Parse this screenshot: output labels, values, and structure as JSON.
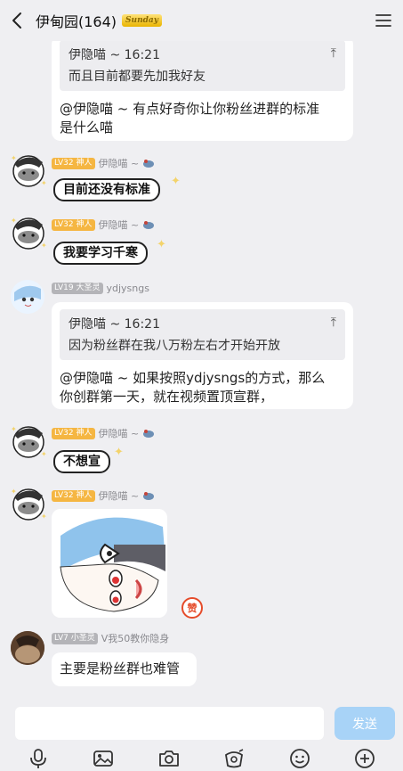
{
  "header": {
    "title": "伊甸园(164)",
    "badge": "Sunday"
  },
  "messages": {
    "m1": {
      "quote_author_time": "伊隐喵 ~  16:21",
      "quote_text": "而且目前都要先加我好友",
      "text_line1": "@伊隐喵 ~  有点好奇你让你粉丝进群的标准",
      "text_line2": "是什么喵"
    },
    "m2": {
      "level": "LV32 神人",
      "name": "伊隐喵 ~",
      "sticker_text": "目前还没有标准"
    },
    "m3": {
      "level": "LV32 神人",
      "name": "伊隐喵 ~",
      "sticker_text": "我要学习千寒"
    },
    "m4": {
      "level": "LV19 大圣灵",
      "name": "ydjysngs",
      "quote_author_time": "伊隐喵 ~  16:21",
      "quote_text": "因为粉丝群在我八万粉左右才开始开放",
      "text_line1": "@伊隐喵 ~  如果按照ydjysngs的方式，那么",
      "text_line2": "你创群第一天，就在视频置顶宣群，"
    },
    "m5": {
      "level": "LV32 神人",
      "name": "伊隐喵 ~",
      "sticker_text": "不想宣"
    },
    "m6": {
      "level": "LV32 神人",
      "name": "伊隐喵 ~",
      "reaction": "赞"
    },
    "m7": {
      "level": "LV7 小圣灵",
      "name": "V我50教你隐身",
      "text": "主要是粉丝群也难管"
    }
  },
  "composer": {
    "placeholder": "",
    "send_label": "发送"
  },
  "toolbar": {
    "items": [
      "microphone-icon",
      "image-icon",
      "camera-icon",
      "red-packet-icon",
      "emoji-icon",
      "plus-icon"
    ]
  },
  "colors": {
    "background": "#efeff2",
    "send_button": "#a8d3f7",
    "level_gold": "#f5b642",
    "level_grey": "#b4b4b8"
  }
}
